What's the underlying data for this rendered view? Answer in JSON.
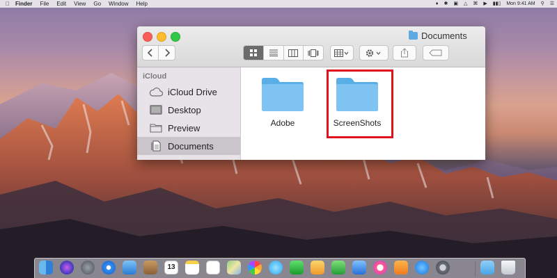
{
  "menubar": {
    "apple_icon": "apple-logo-icon",
    "items": [
      "Finder",
      "File",
      "Edit",
      "View",
      "Go",
      "Window",
      "Help"
    ],
    "clock": "Mon 9:41 AM",
    "status_icons": [
      "dropbox-icon",
      "bluetooth-icon",
      "display-icon",
      "airplay-icon",
      "wifi-icon",
      "volume-icon",
      "battery-icon",
      "spotlight-icon",
      "notification-center-icon"
    ]
  },
  "finder": {
    "title": "Documents",
    "sidebar": {
      "section": "iCloud",
      "items": [
        {
          "label": "iCloud Drive",
          "icon": "cloud-icon"
        },
        {
          "label": "Desktop",
          "icon": "desktop-icon"
        },
        {
          "label": "Preview",
          "icon": "folder-icon"
        },
        {
          "label": "Documents",
          "icon": "documents-icon"
        }
      ]
    },
    "items": [
      {
        "name": "Adobe"
      },
      {
        "name": "ScreenShots"
      }
    ]
  },
  "colors": {
    "folder_blue": "#66b7ee",
    "highlight_red": "#e0111b",
    "selection": "#cac5cb"
  },
  "dock": {
    "calendar_day": "13",
    "apps": [
      "finder-icon",
      "siri-icon",
      "launchpad-icon",
      "safari-icon",
      "mail-icon",
      "contacts-icon",
      "calendar-icon",
      "notes-icon",
      "reminders-icon",
      "maps-icon",
      "photos-icon",
      "messages-icon",
      "facetime-icon",
      "pages-icon",
      "numbers-icon",
      "keynote-icon",
      "itunes-icon",
      "ibooks-icon",
      "app-store-icon",
      "system-preferences-icon",
      "downloads-folder-icon",
      "trash-icon"
    ]
  }
}
